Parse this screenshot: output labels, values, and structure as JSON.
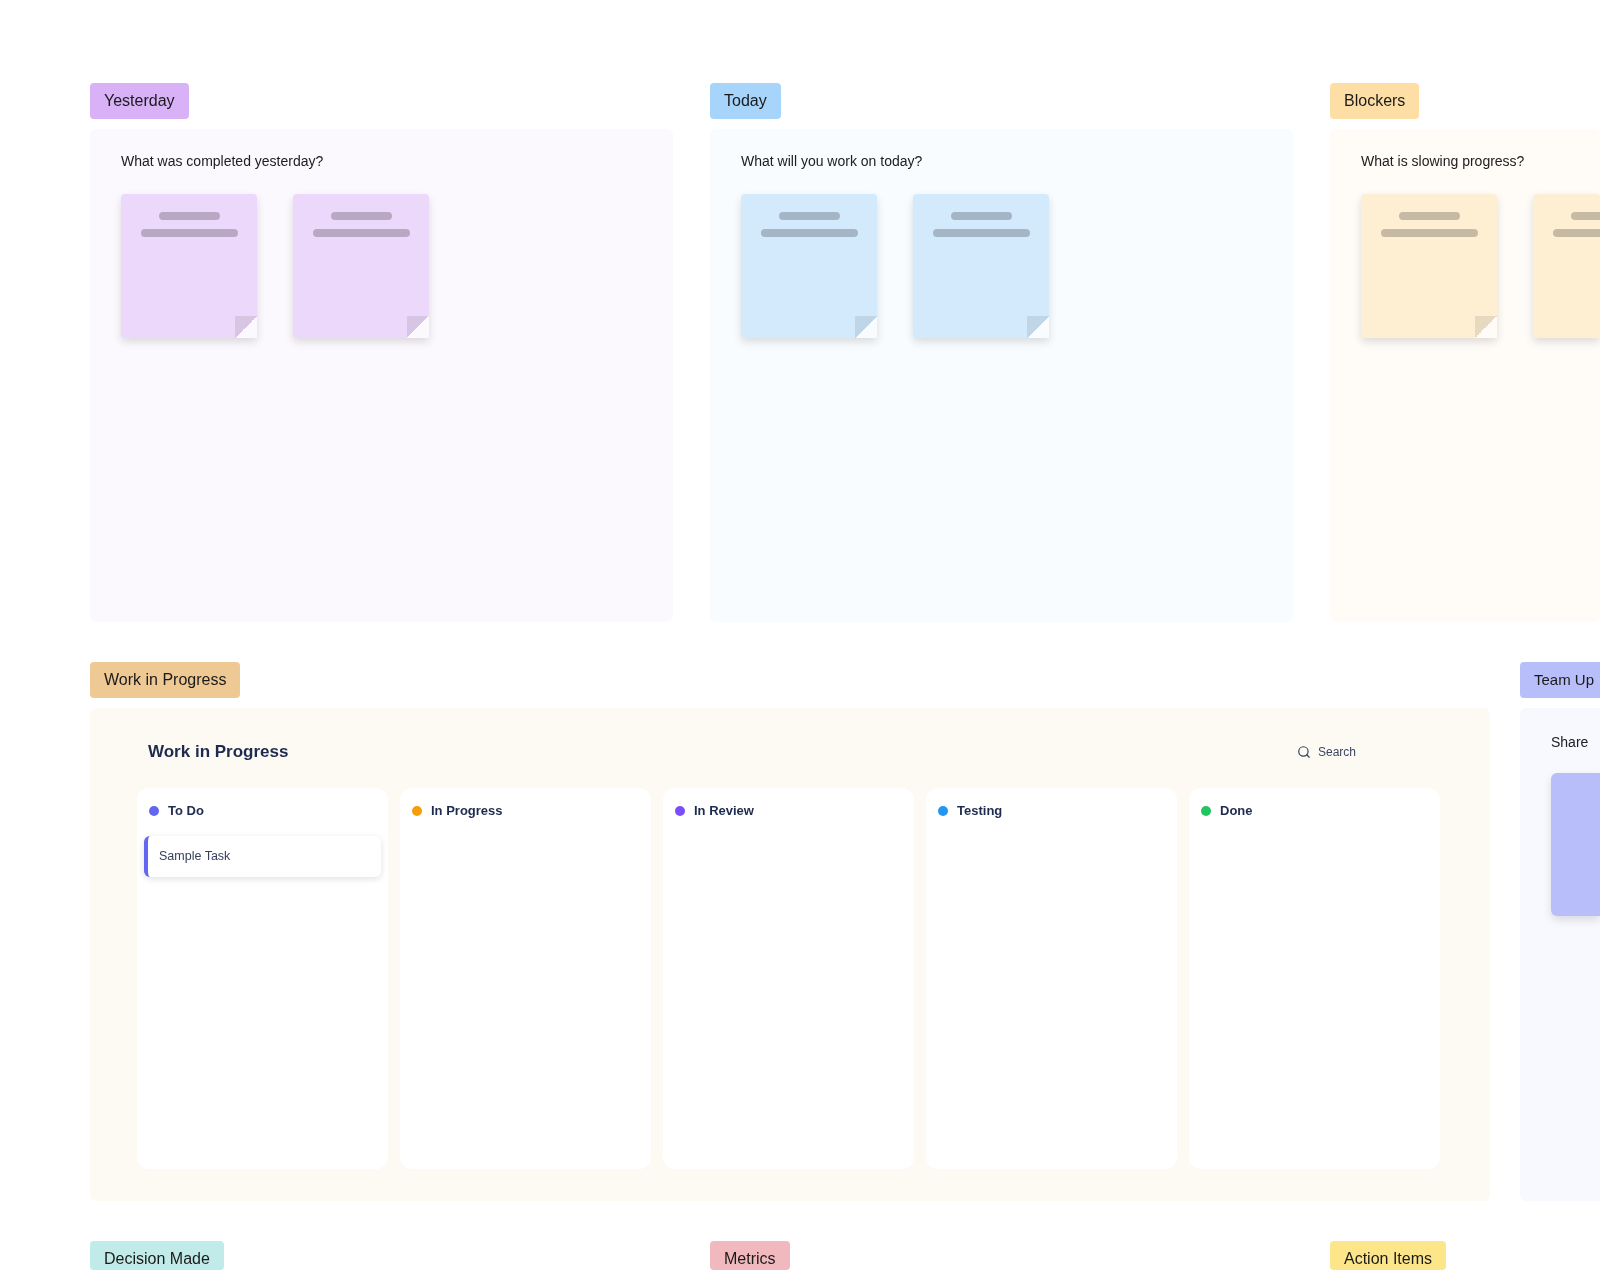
{
  "sections": [
    {
      "label": "Yesterday",
      "color": "#d8b1f7",
      "prompt": "What was completed yesterday?",
      "notes": [
        {
          "kind": "sticky"
        },
        {
          "kind": "sticky"
        }
      ]
    },
    {
      "label": "Today",
      "color": "#a7d4fa",
      "prompt": "What will you work on today?",
      "notes": [
        {
          "kind": "sticky"
        },
        {
          "kind": "sticky"
        }
      ]
    },
    {
      "label": "Blockers",
      "color": "#fddfa5",
      "prompt": "What is slowing progress?",
      "notes": [
        {
          "kind": "sticky"
        },
        {
          "kind": "sticky"
        }
      ]
    }
  ],
  "work_in_progress": {
    "label": "Work in Progress",
    "color": "#eec993",
    "board": {
      "title": "Work in Progress",
      "search": {
        "placeholder": "Search"
      },
      "columns": [
        {
          "name": "To Do",
          "color": "#6366f1",
          "tasks": [
            {
              "title": "Sample Task"
            }
          ]
        },
        {
          "name": "In Progress",
          "color": "#f59e0b"
        },
        {
          "name": "In Review",
          "color": "#7c4dfa"
        },
        {
          "name": "Testing",
          "color": "#2196f3"
        },
        {
          "name": "Done",
          "color": "#22c55e"
        }
      ]
    }
  },
  "team_updates": {
    "label": "Team Up",
    "color": "#b8befa",
    "prompt": "Share",
    "notes": [
      {
        "kind": "plain"
      }
    ]
  },
  "lower_sections": [
    {
      "label": "Decision Made",
      "color": "#c1ebe8"
    },
    {
      "label": "Metrics",
      "color": "#f1b8bd"
    },
    {
      "label": "Action Items",
      "color": "#fde68a"
    }
  ]
}
